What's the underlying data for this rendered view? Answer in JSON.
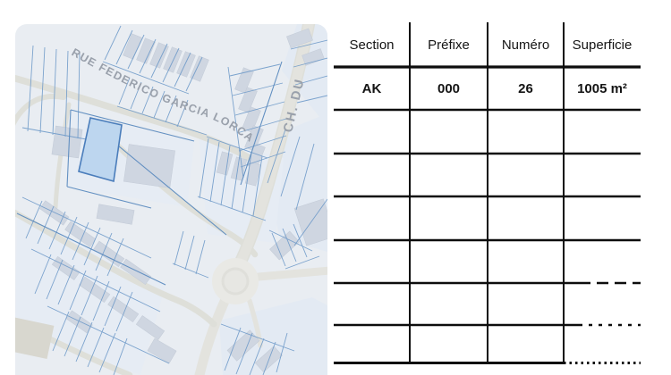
{
  "map": {
    "street_labels": [
      {
        "id": "rue-federico-garcia-lorca",
        "text": "RUE FEDERICO GARCIA LORCA"
      },
      {
        "id": "ch-du",
        "text": "CH. DU"
      }
    ],
    "colors": {
      "background": "#e9edf2",
      "parcel_line": "#6f9ac9",
      "block_line": "#5c8bbf",
      "building_fill": "#cfd6e1",
      "road_fill": "#dedfd9",
      "highlight_fill": "#bdd6ef",
      "highlight_stroke": "#4a7dbb",
      "street_label": "#99a0ab"
    }
  },
  "table": {
    "headers": [
      "Section",
      "Préfixe",
      "Numéro",
      "Superficie"
    ],
    "rows": [
      {
        "section": "AK",
        "prefixe": "000",
        "numero": "26",
        "superficie": "1005 m²"
      }
    ],
    "empty_rows": 6,
    "line_color": "#0d0d0d"
  }
}
